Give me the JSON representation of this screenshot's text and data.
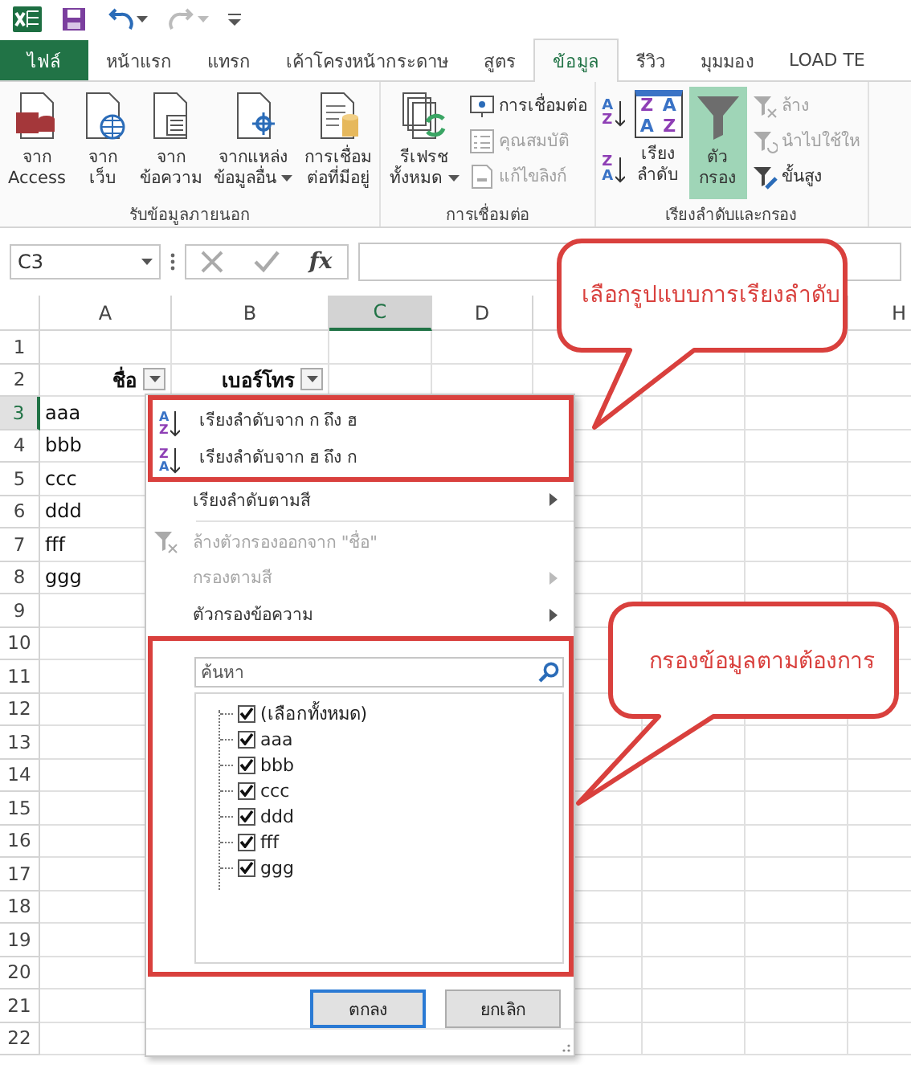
{
  "quick_access": {
    "undo_disabled": false,
    "redo_disabled": true
  },
  "tabs": [
    {
      "label": "ไฟล์",
      "kind": "file",
      "selected": false
    },
    {
      "label": "หน้าแรก",
      "kind": "tab",
      "selected": false
    },
    {
      "label": "แทรก",
      "kind": "tab",
      "selected": false
    },
    {
      "label": "เค้าโครงหน้ากระดาษ",
      "kind": "tab",
      "selected": false
    },
    {
      "label": "สูตร",
      "kind": "tab",
      "selected": false
    },
    {
      "label": "ข้อมูล",
      "kind": "tab",
      "selected": true
    },
    {
      "label": "รีวิว",
      "kind": "tab",
      "selected": false
    },
    {
      "label": "มุมมอง",
      "kind": "tab",
      "selected": false
    },
    {
      "label": "LOAD TE",
      "kind": "tab",
      "selected": false
    }
  ],
  "ribbon": {
    "groups": [
      {
        "label": "รับข้อมูลภายนอก",
        "items": [
          {
            "kind": "large",
            "lines": [
              "จาก",
              "Access"
            ],
            "selected": false
          },
          {
            "kind": "large",
            "lines": [
              "จาก",
              "เว็บ"
            ],
            "selected": false
          },
          {
            "kind": "large",
            "lines": [
              "จาก",
              "ข้อความ"
            ],
            "selected": false
          },
          {
            "kind": "large",
            "lines": [
              "จากแหล่ง",
              "ข้อมูลอื่น"
            ],
            "dropdown": true,
            "selected": false
          },
          {
            "kind": "large",
            "lines": [
              "การเชื่อม",
              "ต่อที่มีอยู่"
            ],
            "selected": false
          }
        ]
      },
      {
        "label": "การเชื่อมต่อ",
        "items": [
          {
            "kind": "large",
            "lines": [
              "รีเฟรช",
              "ทั้งหมด"
            ],
            "dropdown": true,
            "selected": false
          },
          {
            "kind": "stack",
            "buttons": [
              {
                "label": "การเชื่อมต่อ",
                "disabled": false
              },
              {
                "label": "คุณสมบัติ",
                "disabled": true
              },
              {
                "label": "แก้ไขลิงก์",
                "disabled": true
              }
            ]
          }
        ]
      },
      {
        "label": "เรียงลำดับและกรอง",
        "items": [
          {
            "kind": "sort_stack",
            "buttons": [
              {
                "glyphs": [
                  "A",
                  "Z"
                ]
              },
              {
                "glyphs": [
                  "Z",
                  "A"
                ]
              }
            ]
          },
          {
            "kind": "large",
            "glyphs": [
              "Z",
              "A",
              "A",
              "Z"
            ],
            "lines": [
              "เรียง",
              "ลำดับ"
            ],
            "selected": false
          },
          {
            "kind": "large",
            "lines": [
              "ตัว",
              "กรอง"
            ],
            "selected": true
          },
          {
            "kind": "stack",
            "buttons": [
              {
                "label": "ล้าง",
                "disabled": true
              },
              {
                "label": "นำไปใช้ให",
                "disabled": true
              },
              {
                "label": "ขั้นสูง",
                "disabled": false
              }
            ]
          }
        ]
      }
    ]
  },
  "formula_bar": {
    "name_box": "C3",
    "function_label": "fx"
  },
  "sheet": {
    "columns": [
      {
        "label": "A",
        "selected": false
      },
      {
        "label": "B",
        "selected": false
      },
      {
        "label": "C",
        "selected": true
      },
      {
        "label": "D",
        "selected": false
      },
      {
        "label": "H",
        "selected": false
      }
    ],
    "rows": [
      {
        "label": "1",
        "selected": false
      },
      {
        "label": "2",
        "selected": false,
        "header": true,
        "col_a": "ชื่อ",
        "col_b": "เบอร์โทร"
      },
      {
        "label": "3",
        "selected": true,
        "col_a": "aaa"
      },
      {
        "label": "4",
        "selected": false,
        "col_a": "bbb"
      },
      {
        "label": "5",
        "selected": false,
        "col_a": "ccc"
      },
      {
        "label": "6",
        "selected": false,
        "col_a": "ddd"
      },
      {
        "label": "7",
        "selected": false,
        "col_a": "fff"
      },
      {
        "label": "8",
        "selected": false,
        "col_a": "ggg"
      },
      {
        "label": "9",
        "selected": false
      },
      {
        "label": "10",
        "selected": false
      },
      {
        "label": "11",
        "selected": false
      },
      {
        "label": "12",
        "selected": false
      },
      {
        "label": "13",
        "selected": false
      },
      {
        "label": "14",
        "selected": false
      },
      {
        "label": "15",
        "selected": false
      },
      {
        "label": "16",
        "selected": false
      },
      {
        "label": "17",
        "selected": false
      },
      {
        "label": "18",
        "selected": false
      },
      {
        "label": "19",
        "selected": false
      },
      {
        "label": "20",
        "selected": false
      },
      {
        "label": "21",
        "selected": false
      },
      {
        "label": "22",
        "selected": false
      }
    ]
  },
  "filter_menu": {
    "items": [
      {
        "kind": "sort",
        "glyphs": [
          "A",
          "Z"
        ],
        "label": "เรียงลำดับจาก ก ถึง ฮ",
        "disabled": false,
        "submenu": false
      },
      {
        "kind": "sort",
        "glyphs": [
          "Z",
          "A"
        ],
        "label": "เรียงลำดับจาก ฮ ถึง ก",
        "disabled": false,
        "submenu": false
      },
      {
        "kind": "plain",
        "label": "เรียงลำดับตามสี",
        "disabled": false,
        "submenu": true
      },
      {
        "kind": "separator"
      },
      {
        "kind": "clear",
        "label": "ล้างตัวกรองออกจาก \"ชื่อ\"",
        "disabled": true,
        "submenu": false
      },
      {
        "kind": "plain",
        "label": "กรองตามสี",
        "disabled": true,
        "submenu": true
      },
      {
        "kind": "plain",
        "label": "ตัวกรองข้อความ",
        "disabled": false,
        "submenu": true
      }
    ],
    "search": {
      "placeholder": "ค้นหา"
    },
    "values": [
      {
        "label": "(เลือกทั้งหมด)",
        "checked": true
      },
      {
        "label": "aaa",
        "checked": true
      },
      {
        "label": "bbb",
        "checked": true
      },
      {
        "label": "ccc",
        "checked": true
      },
      {
        "label": "ddd",
        "checked": true
      },
      {
        "label": "fff",
        "checked": true
      },
      {
        "label": "ggg",
        "checked": true
      }
    ],
    "buttons": [
      {
        "label": "ตกลง",
        "default": true
      },
      {
        "label": "ยกเลิก",
        "default": false
      }
    ]
  },
  "callouts": [
    {
      "text": "เลือกรูปแบบการเรียงลำดับ"
    },
    {
      "text": "กรองข้อมูลตามต้องการ"
    }
  ]
}
